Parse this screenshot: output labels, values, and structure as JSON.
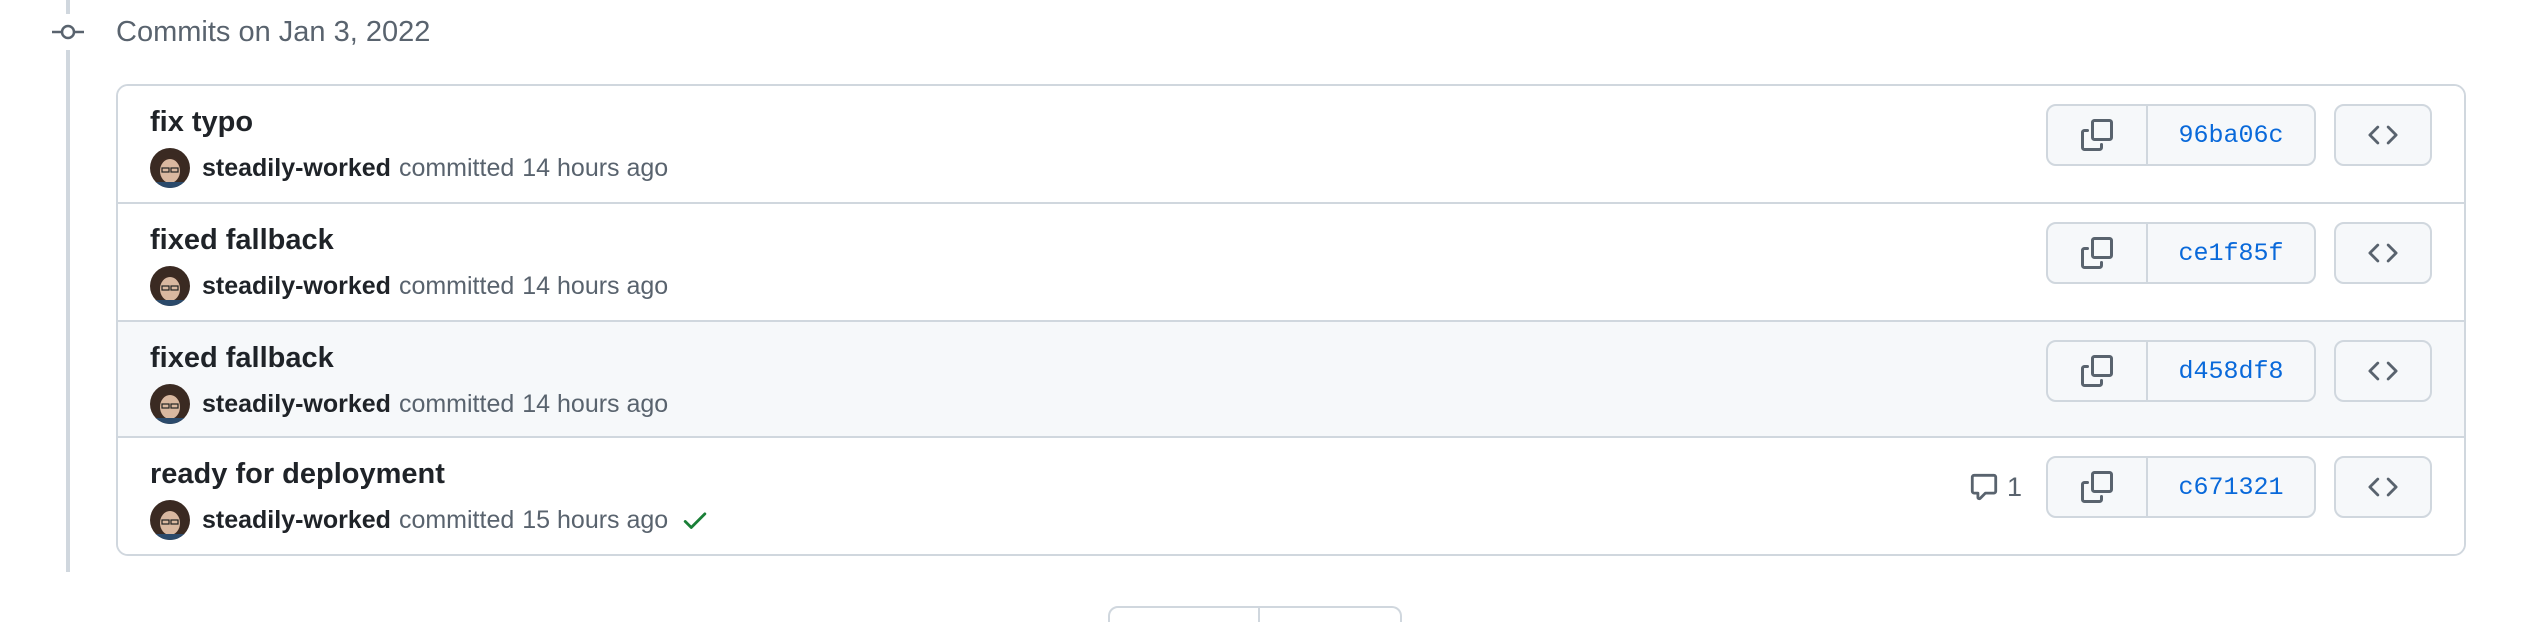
{
  "group": {
    "title": "Commits on Jan 3, 2022"
  },
  "commits": [
    {
      "title": "fix typo",
      "author": "steadily-worked",
      "committed_label": "committed",
      "time": "14 hours ago",
      "sha": "96ba06c"
    },
    {
      "title": "fixed fallback",
      "author": "steadily-worked",
      "committed_label": "committed",
      "time": "14 hours ago",
      "sha": "ce1f85f"
    },
    {
      "title": "fixed fallback",
      "author": "steadily-worked",
      "committed_label": "committed",
      "time": "14 hours ago",
      "sha": "d458df8"
    },
    {
      "title": "ready for deployment",
      "author": "steadily-worked",
      "committed_label": "committed",
      "time": "15 hours ago",
      "sha": "c671321",
      "comment_count": "1",
      "status": "success"
    }
  ],
  "colors": {
    "link": "#0969da",
    "success": "#1a7f37",
    "border": "#d0d7de",
    "muted": "#59636e"
  },
  "icons": {
    "timeline": "git-commit-icon",
    "copy": "copy-icon",
    "browse": "code-icon",
    "comment": "comment-icon",
    "status": "check-icon"
  }
}
